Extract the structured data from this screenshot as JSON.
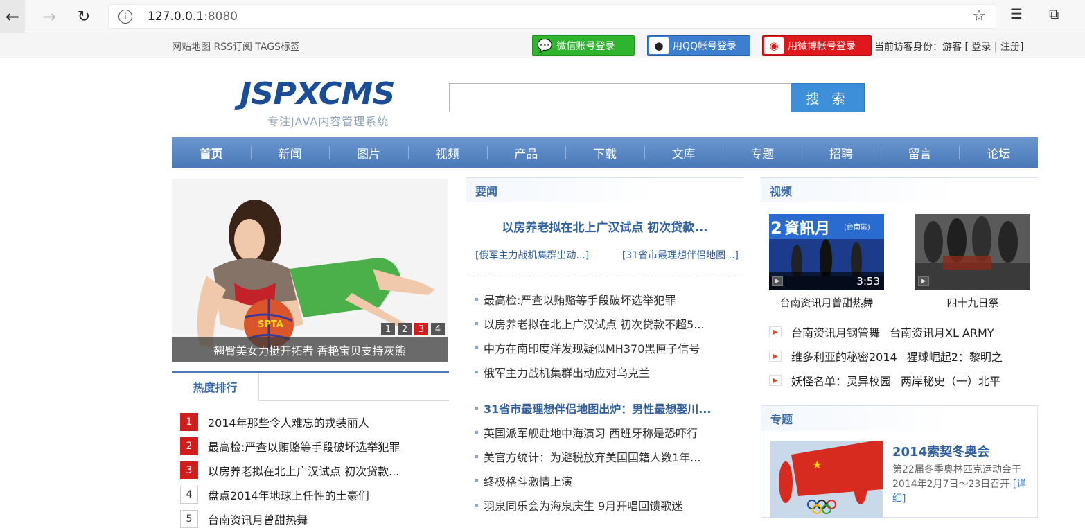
{
  "browser": {
    "url_host": "127.0.0.1",
    "url_port": ":8080",
    "info_symbol": "i"
  },
  "topbar": {
    "links": "网站地图 RSS订阅 TAGS标签",
    "wechat_login": "微信账号登录",
    "qq_login": "用QQ帐号登录",
    "weibo_login": "用微博帐号登录",
    "visitor_prefix": "当前访客身份：游客 [",
    "login": "登录",
    "separator": "|",
    "register": "注册",
    "suffix": "]"
  },
  "header": {
    "logo_text": "JSPXCMS",
    "logo_subtitle": "专注JAVA内容管理系统",
    "search_button": "搜 索",
    "search_value": ""
  },
  "nav": [
    "首页",
    "新闻",
    "图片",
    "视频",
    "产品",
    "下载",
    "文库",
    "专题",
    "招聘",
    "留言",
    "论坛"
  ],
  "slideshow": {
    "caption": "翘臀美女力挺开拓者 香艳宝贝支持灰熊",
    "pages": [
      "1",
      "2",
      "3",
      "4"
    ],
    "current_page": 3,
    "ball_text": "SPTA"
  },
  "hot": {
    "title": "热度排行",
    "items": [
      {
        "rank": "1",
        "text": "2014年那些令人难忘的戎装丽人"
      },
      {
        "rank": "2",
        "text": "最高检:严查以贿赂等手段破坏选举犯罪"
      },
      {
        "rank": "3",
        "text": "以房养老拟在北上广汉试点 初次贷款..."
      },
      {
        "rank": "4",
        "text": "盘点2014年地球上任性的土豪们"
      },
      {
        "rank": "5",
        "text": "台南资讯月曾甜热舞"
      }
    ]
  },
  "news": {
    "title": "要闻",
    "headline": "以房养老拟在北上广汉试点 初次贷款...",
    "sub1": "[俄军主力战机集群出动...]",
    "sub2": "[31省市最理想伴侣地图...]",
    "group1": [
      "最高检:严查以贿赂等手段破坏选举犯罪",
      "以房养老拟在北上广汉试点 初次贷款不超5...",
      "中方在南印度洋发现疑似MH370黑匣子信号",
      "俄军主力战机集群出动应对乌克兰"
    ],
    "group2_headline": "31省市最理想伴侣地图出炉：男性最想娶川...",
    "group2": [
      "英国派军舰赴地中海演习 西班牙称是恐吓行",
      "美官方统计：为避税放弃美国国籍人数1年...",
      "终极格斗激情上演",
      "羽泉同乐会为海泉庆生 9月开唱回馈歌迷"
    ]
  },
  "video": {
    "title": "视频",
    "thumb1_time": "3:53",
    "thumb1_caption": "台南资讯月曾甜热舞",
    "thumb1_overlay": "資訊月",
    "thumb1_overlay2": "(台南區)",
    "thumb1_overlay_num": "2",
    "thumb2_caption": "四十九日祭",
    "list": [
      [
        "台南资讯月钢管舞",
        "台南资讯月XL ARMY"
      ],
      [
        "维多利亚的秘密2014",
        "猩球崛起2：黎明之"
      ],
      [
        "妖怪名单：灵异校园",
        "两岸秘史（一）北平"
      ]
    ]
  },
  "topic": {
    "title": "专题",
    "item_title": "2014索契冬奥会",
    "item_desc": "第22届冬季奥林匹克运动会于2014年2月7日～23日召开",
    "more_link": "[详细]"
  },
  "colors": {
    "brand_blue": "#1a4c97",
    "nav_blue": "#4a79b8",
    "rank_red": "#d21d1d",
    "wechat_green": "#2fb42d",
    "weibo_red": "#e1181b"
  }
}
